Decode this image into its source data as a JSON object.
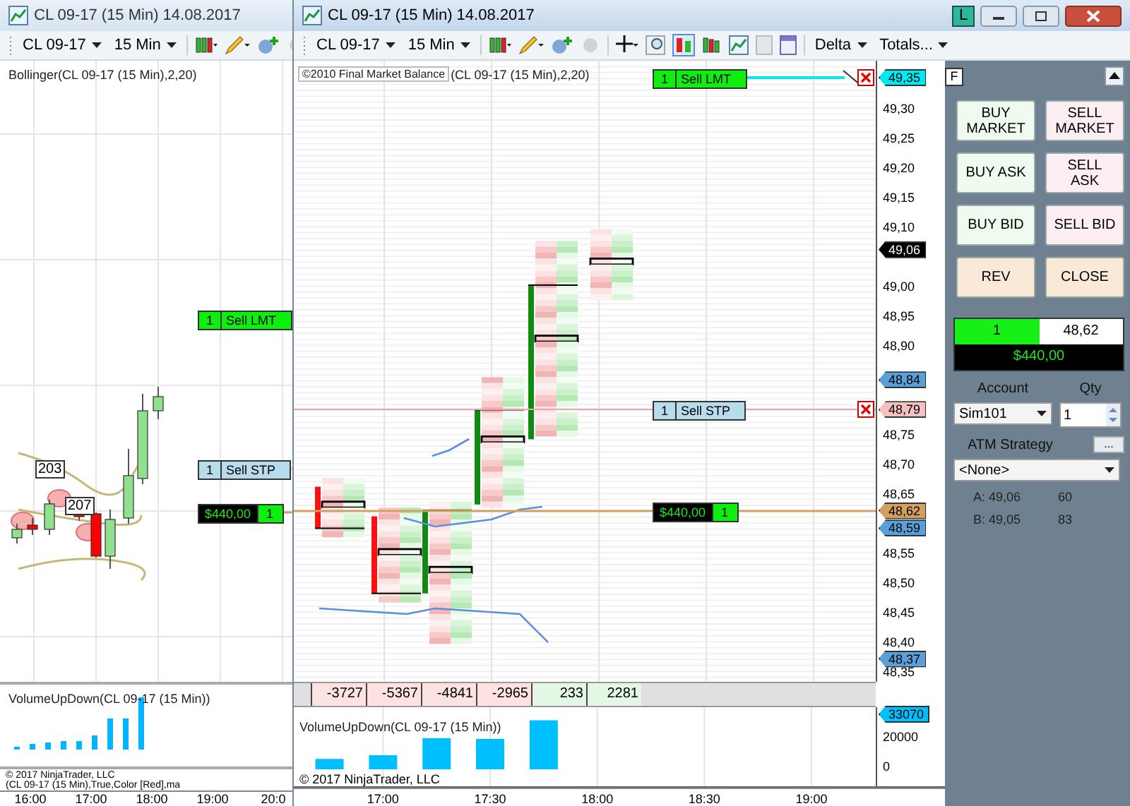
{
  "left_window": {
    "title": "CL 09-17 (15 Min)  14.08.2017",
    "toolbar": {
      "instrument": "CL 09-17",
      "interval": "15 Min"
    },
    "indicator_label": "Bollinger(CL 09-17 (15 Min),2,20)",
    "orders": [
      {
        "kind": "limit",
        "quantity": "1",
        "label": "Sell LMT"
      },
      {
        "kind": "stop",
        "quantity": "1",
        "label": "Sell STP"
      },
      {
        "kind": "position",
        "label": "$440,00",
        "quantity": "1"
      }
    ],
    "bar_labels": [
      "203",
      "207"
    ],
    "volume_label": "VolumeUpDown(CL 09-17 (15 Min))",
    "footer_texts": [
      "© 2017 NinjaTrader, LLC",
      "(CL 09-17 (15 Min),True,Color [Red],ma"
    ],
    "time_axis": [
      "16:00",
      "17:00",
      "18:00",
      "19:00",
      "20:0"
    ]
  },
  "main_window": {
    "title": "CL 09-17 (15 Min)  14.08.2017",
    "window_badge": "L",
    "toolbar": {
      "instrument": "CL 09-17",
      "interval": "15 Min",
      "menus": [
        "Delta",
        "Totals..."
      ]
    },
    "copyright_badge": "©2010 Final Market Balance",
    "indicator_label": "(CL 09-17 (15 Min),2,20)",
    "orders": [
      {
        "kind": "limit",
        "quantity": "1",
        "label": "Sell LMT"
      },
      {
        "kind": "stop",
        "quantity": "1",
        "label": "Sell STP"
      },
      {
        "kind": "position",
        "label": "$440,00",
        "quantity": "1"
      }
    ],
    "price_axis": {
      "ticks": [
        "49,30",
        "49,25",
        "49,20",
        "49,15",
        "49,10",
        "49,00",
        "48,95",
        "48,90",
        "48,75",
        "48,70",
        "48,65",
        "48,55",
        "48,50",
        "48,45",
        "48,40",
        "48,35"
      ],
      "markers": [
        {
          "price": "49,35",
          "color": "#00e8f0"
        },
        {
          "price": "49,06",
          "color": "#000000"
        },
        {
          "price": "48,84",
          "color": "#5aa0d8"
        },
        {
          "price": "48,79",
          "color": "#f4c0c0"
        },
        {
          "price": "48,62",
          "color": "#d2a060"
        },
        {
          "price": "48,59",
          "color": "#5aa0d8"
        },
        {
          "price": "48,37",
          "color": "#5aa0d8"
        }
      ]
    },
    "delta_row": [
      {
        "value": "-3727",
        "color": "#fde2e2"
      },
      {
        "value": "-5367",
        "color": "#fde2e2"
      },
      {
        "value": "-4841",
        "color": "#fde2e2"
      },
      {
        "value": "-2965",
        "color": "#fde2e2"
      },
      {
        "value": "233",
        "color": "#e4f7e4"
      },
      {
        "value": "2281",
        "color": "#e4f7e4"
      }
    ],
    "volume_panel": {
      "label": "VolumeUpDown(CL 09-17 (15 Min))",
      "last_value": "33070",
      "copyright": "© 2017 NinjaTrader, LLC",
      "chart_data": {
        "type": "bar",
        "x": [
          1005,
          1020,
          1035,
          1050,
          1065
        ],
        "values": [
          7000,
          9500,
          21000,
          20500,
          33070
        ],
        "xlim": [
          995,
          1177
        ],
        "grid": true,
        "ylim": [
          0,
          40000
        ],
        "yticks": [
          0,
          20000
        ],
        "xticks": [
          {
            "value": 1020,
            "label": "17:00"
          },
          {
            "value": 1050,
            "label": "17:30"
          },
          {
            "value": 1080,
            "label": "18:00"
          },
          {
            "value": 1110,
            "label": "18:30"
          },
          {
            "value": 1140,
            "label": "19:00"
          }
        ]
      }
    },
    "panel_toggle": "F"
  },
  "order_panel": {
    "buttons": [
      {
        "label": "BUY MARKET",
        "kind": "buy"
      },
      {
        "label": "SELL MARKET",
        "kind": "sell"
      },
      {
        "label": "BUY ASK",
        "kind": "buy"
      },
      {
        "label": "SELL ASK",
        "kind": "sell"
      },
      {
        "label": "BUY BID",
        "kind": "buy"
      },
      {
        "label": "SELL BID",
        "kind": "sell"
      },
      {
        "label": "REV",
        "kind": "neutral"
      },
      {
        "label": "CLOSE",
        "kind": "neutral"
      }
    ],
    "position": {
      "quantity": "1",
      "price": "48,62",
      "pnl": "$440,00"
    },
    "account": {
      "label": "Account",
      "value": "Sim101"
    },
    "qty": {
      "label": "Qty",
      "value": "1"
    },
    "atm": {
      "label": "ATM Strategy",
      "button": "...",
      "value": "<None>"
    },
    "quotes": [
      {
        "price": "A: 49,06",
        "size": "60"
      },
      {
        "price": "B: 49,05",
        "size": "83"
      }
    ]
  }
}
